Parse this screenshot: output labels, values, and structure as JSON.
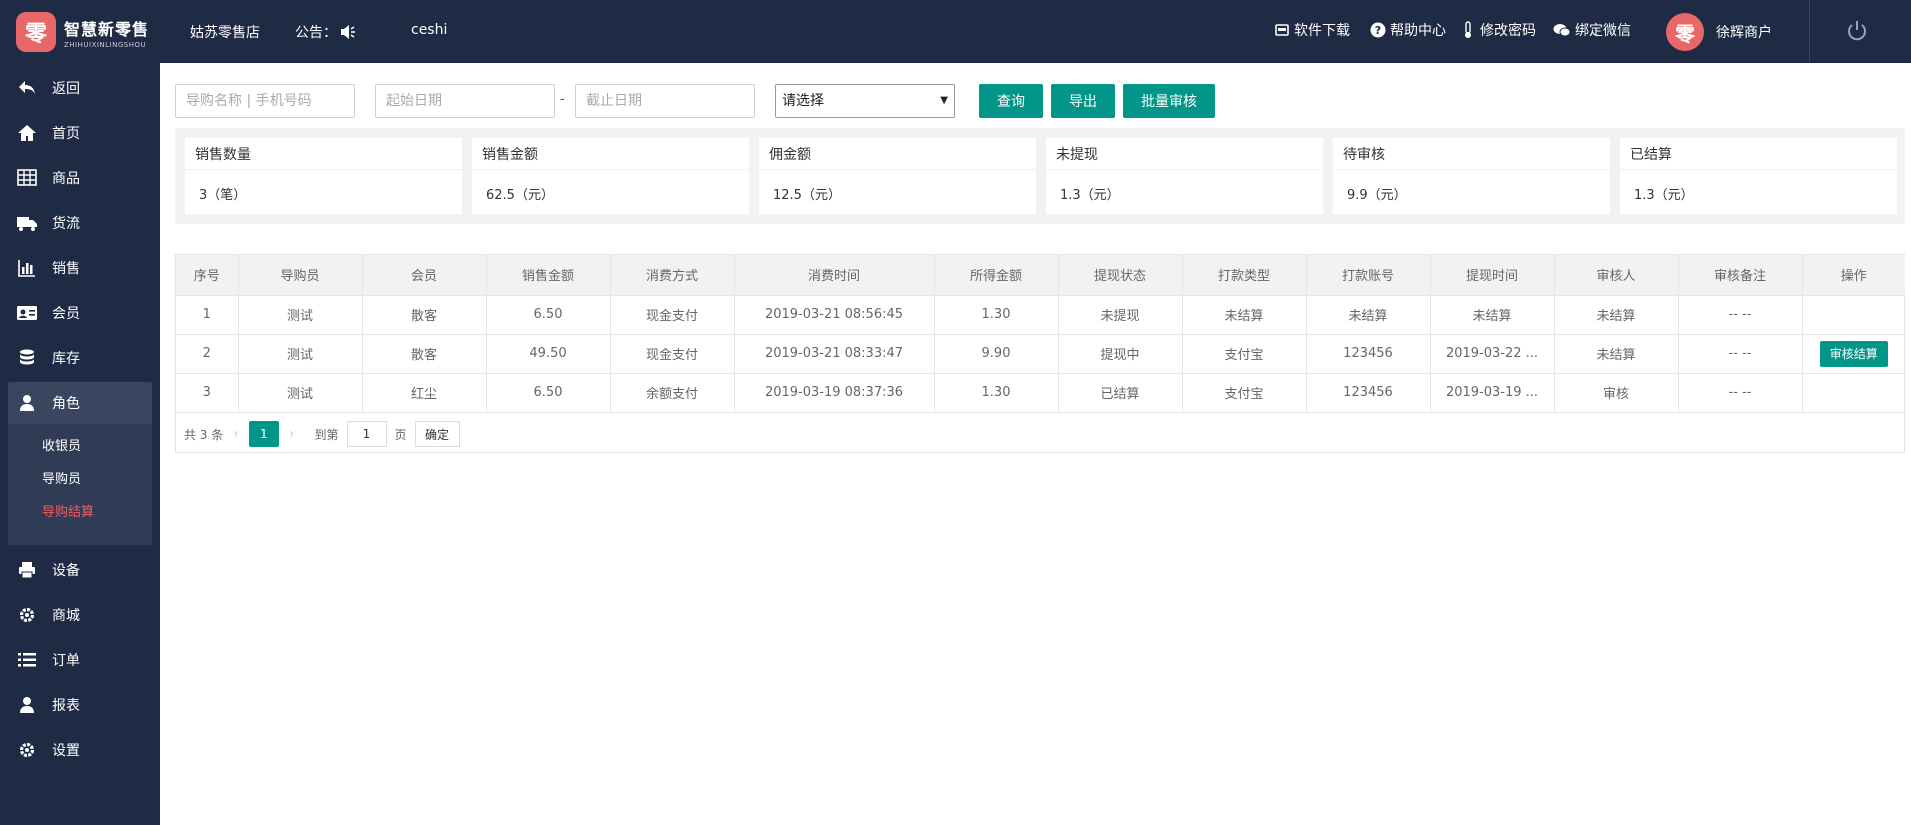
{
  "brand": {
    "logo_glyph": "零",
    "name_cn": "智慧新零售",
    "name_en": "ZHIHUIXINLINGSHOU"
  },
  "header": {
    "store": "姑苏零售店",
    "notice_label": "公告：",
    "notice_text": "ceshi",
    "links": [
      "软件下载",
      "帮助中心",
      "修改密码",
      "绑定微信"
    ],
    "user": "徐辉商户",
    "avatar_glyph": "零"
  },
  "sidebar": {
    "items": [
      {
        "label": "返回",
        "icon": "back-arrow-icon"
      },
      {
        "label": "首页",
        "icon": "home-icon"
      },
      {
        "label": "商品",
        "icon": "table-icon"
      },
      {
        "label": "货流",
        "icon": "truck-icon"
      },
      {
        "label": "销售",
        "icon": "bar-chart-icon"
      },
      {
        "label": "会员",
        "icon": "id-card-icon"
      },
      {
        "label": "库存",
        "icon": "database-icon"
      },
      {
        "label": "角色",
        "icon": "user-icon"
      },
      {
        "label": "设备",
        "icon": "printer-icon"
      },
      {
        "label": "商城",
        "icon": "gear-icon"
      },
      {
        "label": "订单",
        "icon": "list-icon"
      },
      {
        "label": "报表",
        "icon": "user-icon"
      },
      {
        "label": "设置",
        "icon": "gear-icon"
      }
    ],
    "submenu": [
      "收银员",
      "导购员",
      "导购结算"
    ]
  },
  "filters": {
    "guide_placeholder": "导购名称 | 手机号码",
    "start_placeholder": "起始日期",
    "end_placeholder": "截止日期",
    "dash": "-",
    "select_value": "请选择",
    "buttons": [
      "查询",
      "导出",
      "批量审核"
    ]
  },
  "stats": [
    {
      "title": "销售数量",
      "value": "3（笔）"
    },
    {
      "title": "销售金额",
      "value": "62.5（元）"
    },
    {
      "title": "佣金额",
      "value": "12.5（元）"
    },
    {
      "title": "未提现",
      "value": "1.3（元）"
    },
    {
      "title": "待审核",
      "value": "9.9（元）"
    },
    {
      "title": "已结算",
      "value": "1.3（元）"
    }
  ],
  "table": {
    "headers": [
      "序号",
      "导购员",
      "会员",
      "销售金额",
      "消费方式",
      "消费时间",
      "所得金额",
      "提现状态",
      "打款类型",
      "打款账号",
      "提现时间",
      "审核人",
      "审核备注",
      "操作"
    ],
    "rows": [
      [
        "1",
        "测试",
        "散客",
        "6.50",
        "现金支付",
        "2019-03-21 08:56:45",
        "1.30",
        "未提现",
        "未结算",
        "未结算",
        "未结算",
        "未结算",
        "-- --",
        ""
      ],
      [
        "2",
        "测试",
        "散客",
        "49.50",
        "现金支付",
        "2019-03-21 08:33:47",
        "9.90",
        "提现中",
        "支付宝",
        "123456",
        "2019-03-22 ...",
        "未结算",
        "-- --",
        "审核结算"
      ],
      [
        "3",
        "测试",
        "红尘",
        "6.50",
        "余额支付",
        "2019-03-19 08:37:36",
        "1.30",
        "已结算",
        "支付宝",
        "123456",
        "2019-03-19 ...",
        "审核",
        "-- --",
        ""
      ]
    ]
  },
  "pager": {
    "total": "共 3 条",
    "current": "1",
    "goto_label": "到第",
    "page_input": "1",
    "page_unit": "页",
    "confirm": "确定"
  },
  "colors": {
    "primary": "#019688",
    "sidebar_bg": "#1f2a44",
    "active_sub": "#ef5f5f"
  }
}
